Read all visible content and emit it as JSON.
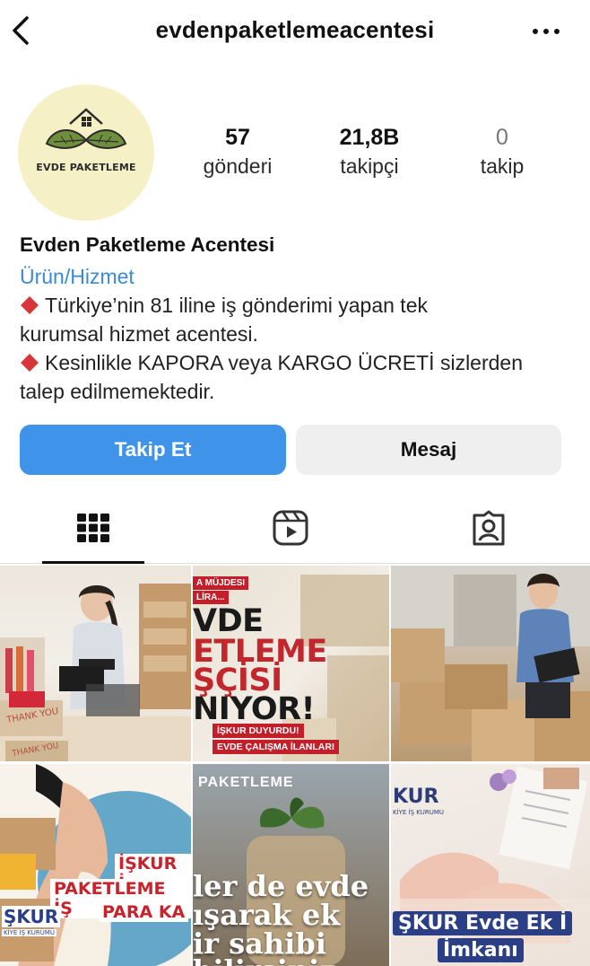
{
  "header": {
    "username": "evdenpaketlemeacentesi",
    "back_icon": "chevron-left-icon",
    "more_icon": "more-horizontal-icon"
  },
  "profile": {
    "avatar_text": "EVDE PAKETLEME",
    "stats": [
      {
        "value": "57",
        "label": "gönderi"
      },
      {
        "value": "21,8B",
        "label": "takipçi"
      },
      {
        "value": "0",
        "label": "takip"
      }
    ]
  },
  "bio": {
    "name": "Evden Paketleme Acentesi",
    "category": "Ürün/Hizmet",
    "line1": "Türkiye’nin 81 iline iş gönderimi yapan tek",
    "line2": "kurumsal hizmet acentesi.",
    "line3": "Kesinlikle KAPORA veya KARGO ÜCRETİ sizlerden",
    "line4": "talep edilmemektedir."
  },
  "actions": {
    "follow": "Takip Et",
    "message": "Mesaj"
  },
  "tabs": {
    "items": [
      "grid-icon",
      "reels-icon",
      "tagged-icon"
    ],
    "active": "grid"
  },
  "posts": {
    "p2": {
      "tag": "A MÜJDESI",
      "tag2": "LİRA...",
      "l1": "VDE",
      "l2": "ETLEME",
      "l3": "ŞÇİSİ",
      "l4": "NIYOR!",
      "band1": "İŞKUR DUYURDU!",
      "band2": "EVDE ÇALIŞMA İLANLARI"
    },
    "p4": {
      "l1": "İŞKUR İ",
      "l2": "PAKETLEME İŞ",
      "l3": "PARA KA",
      "logo": "ŞKUR",
      "sub": "KİYE İŞ KURUMU"
    },
    "p5": {
      "tag": "PAKETLEME",
      "l1": "ler de evde",
      "l2": "ışarak ek",
      "l3": "ir sahibi",
      "l4": "bilirsiniz."
    },
    "p6": {
      "logo": "KUR",
      "sub": "KİYE İŞ KURUMU",
      "chip1": "ŞKUR Evde Ek İ",
      "chip2": "İmkanı"
    }
  },
  "colors": {
    "follow_bg": "#3f94ea",
    "message_bg": "#efefef",
    "category": "#3b8ad6",
    "diamond": "#d7373a"
  }
}
